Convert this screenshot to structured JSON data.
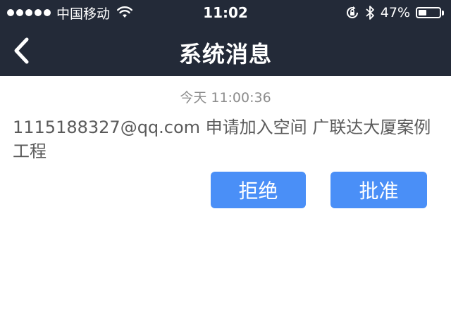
{
  "status_bar": {
    "carrier": "中国移动",
    "time": "11:02",
    "battery_percent": "47%",
    "battery_level": 0.47,
    "icons": [
      "signal-dots-icon",
      "wifi-icon",
      "rotation-lock-icon",
      "bluetooth-icon",
      "battery-icon"
    ]
  },
  "nav": {
    "title": "系统消息",
    "back_icon": "chevron-left-icon"
  },
  "message": {
    "timestamp": "今天 11:00:36",
    "text": "1115188327@qq.com 申请加入空间 广联达大厦案例工程",
    "reject_label": "拒绝",
    "approve_label": "批准"
  },
  "colors": {
    "header_bg": "#232a38",
    "button_bg": "#4a8ff7",
    "timestamp": "#8c8c8c",
    "message_text": "#5a5a5a"
  }
}
